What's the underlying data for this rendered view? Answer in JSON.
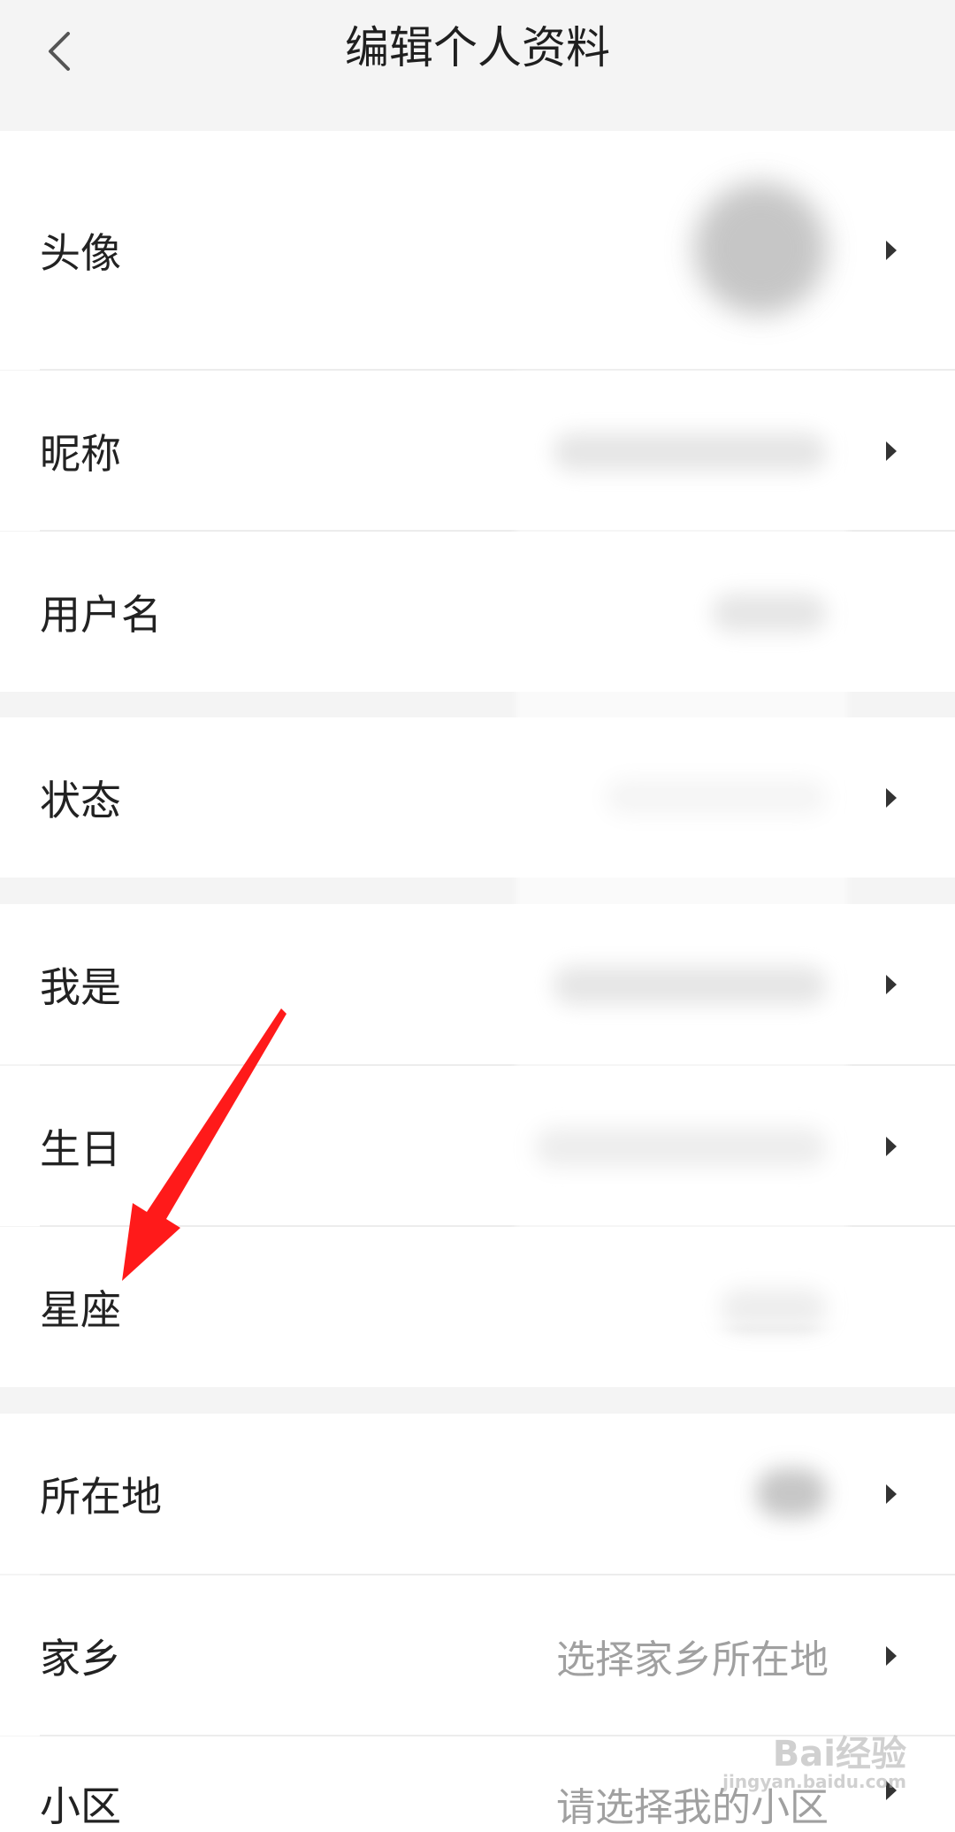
{
  "header": {
    "title": "编辑个人资料"
  },
  "rows": {
    "avatar": {
      "label": "头像"
    },
    "nickname": {
      "label": "昵称"
    },
    "username": {
      "label": "用户名"
    },
    "status": {
      "label": "状态"
    },
    "i_am": {
      "label": "我是"
    },
    "birthday": {
      "label": "生日"
    },
    "zodiac": {
      "label": "星座"
    },
    "location": {
      "label": "所在地"
    },
    "hometown": {
      "label": "家乡",
      "placeholder": "选择家乡所在地"
    },
    "community": {
      "label": "小区",
      "placeholder": "请选择我的小区"
    }
  },
  "watermark": {
    "brand": "Bai经验",
    "url": "jingyan.baidu.com"
  },
  "colors": {
    "annotation_arrow": "#ff1a1a",
    "background": "#f4f4f4",
    "row": "#ffffff"
  }
}
